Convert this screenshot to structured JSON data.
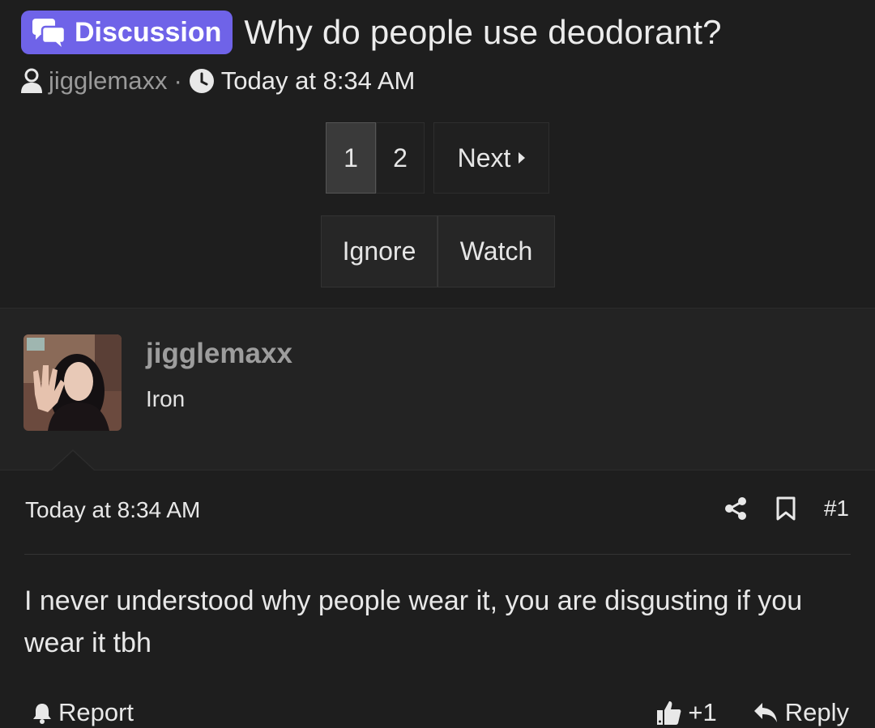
{
  "thread": {
    "badge_label": "Discussion",
    "title": "Why do people use deodorant?",
    "author": "jigglemaxx",
    "separator": "·",
    "time": "Today at 8:34 AM"
  },
  "pagination": {
    "current": "1",
    "page2": "2",
    "next_label": "Next"
  },
  "thread_actions": {
    "ignore": "Ignore",
    "watch": "Watch"
  },
  "post": {
    "username": "jigglemaxx",
    "user_title": "Iron",
    "date": "Today at 8:34 AM",
    "number": "#1",
    "body": "I never understood why people wear it, you are disgusting if you wear it tbh",
    "report_label": "Report",
    "like_count": "+1",
    "reply_label": "Reply"
  },
  "colors": {
    "background": "#1e1e1e",
    "badge": "#6f63e8",
    "muted_text": "#9a9a9a"
  },
  "icons": [
    "comments-icon",
    "user-icon",
    "clock-icon",
    "caret-right-icon",
    "share-icon",
    "bookmark-icon",
    "bell-icon",
    "thumbs-up-icon",
    "reply-icon"
  ]
}
